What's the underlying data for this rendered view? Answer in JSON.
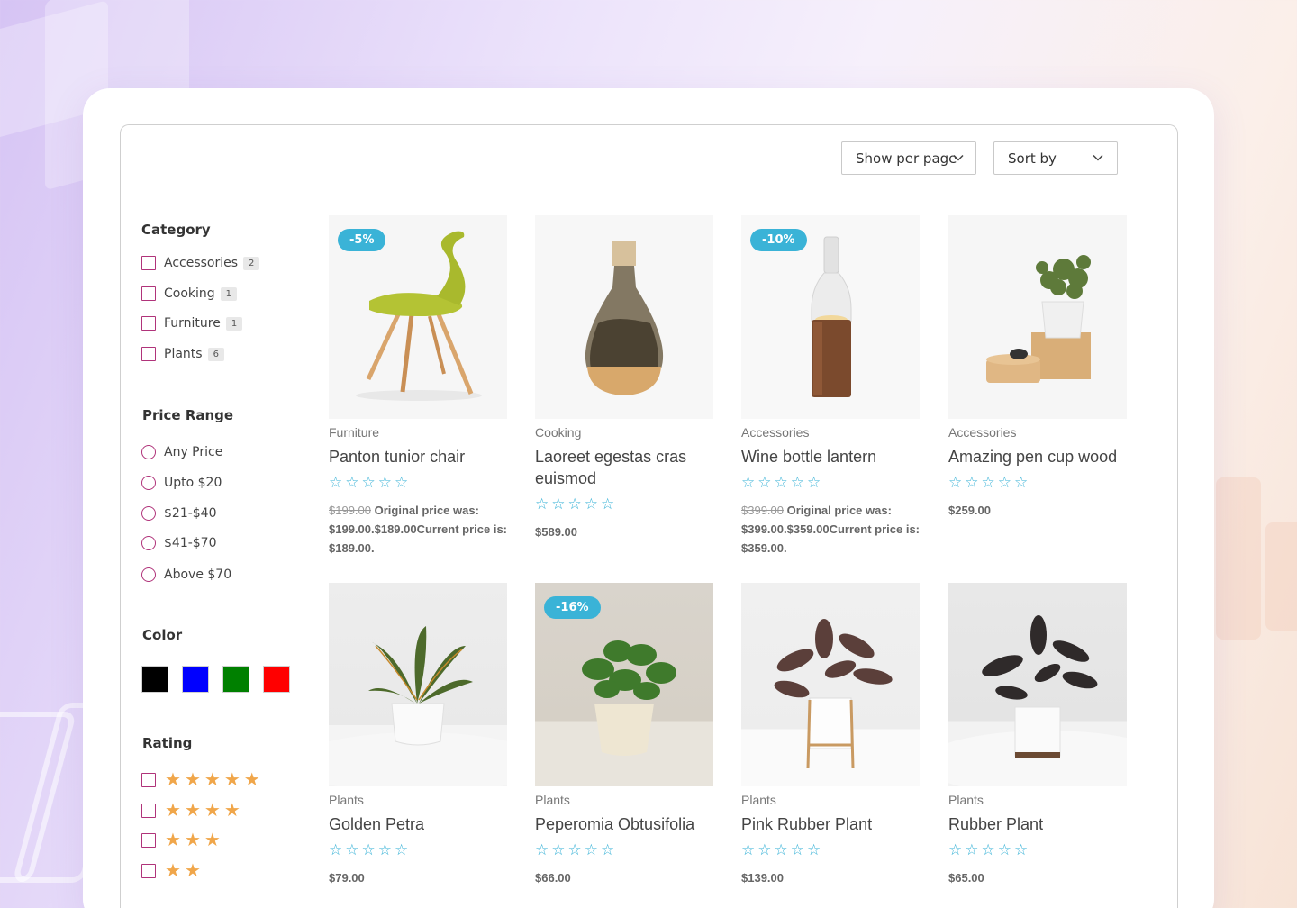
{
  "toolbar": {
    "per_page_label": "Show per page",
    "sort_label": "Sort by"
  },
  "sidebar": {
    "category_title": "Category",
    "categories": [
      {
        "label": "Accessories",
        "count": "2"
      },
      {
        "label": "Cooking",
        "count": "1"
      },
      {
        "label": "Furniture",
        "count": "1"
      },
      {
        "label": "Plants",
        "count": "6"
      }
    ],
    "price_title": "Price Range",
    "prices": [
      "Any Price",
      "Upto $20",
      "$21-$40",
      "$41-$70",
      "Above $70"
    ],
    "color_title": "Color",
    "colors": [
      "#000000",
      "#0000ff",
      "#008000",
      "#ff0000"
    ],
    "rating_title": "Rating",
    "ratings": [
      5,
      4,
      3,
      2
    ]
  },
  "products": [
    {
      "badge": "-5%",
      "category": "Furniture",
      "name": "Panton tunior chair",
      "old_price": "$199.00",
      "price_text": " Original price was: $199.00.$189.00Current price is: $189.00.",
      "rating": 0
    },
    {
      "badge": "",
      "category": "Cooking",
      "name": "Laoreet egestas cras euismod",
      "old_price": "",
      "price_text": "$589.00",
      "rating": 0
    },
    {
      "badge": "-10%",
      "category": "Accessories",
      "name": "Wine bottle lantern",
      "old_price": "$399.00",
      "price_text": " Original price was: $399.00.$359.00Current price is: $359.00.",
      "rating": 0
    },
    {
      "badge": "",
      "category": "Accessories",
      "name": "Amazing pen cup wood",
      "old_price": "",
      "price_text": "$259.00",
      "rating": 0
    },
    {
      "badge": "",
      "category": "Plants",
      "name": "Golden Petra",
      "old_price": "",
      "price_text": "$79.00",
      "rating": 0
    },
    {
      "badge": "-16%",
      "category": "Plants",
      "name": "Peperomia Obtusifolia",
      "old_price": "",
      "price_text": "$66.00",
      "rating": 0
    },
    {
      "badge": "",
      "category": "Plants",
      "name": "Pink Rubber Plant",
      "old_price": "",
      "price_text": "$139.00",
      "rating": 0
    },
    {
      "badge": "",
      "category": "Plants",
      "name": "Rubber Plant",
      "old_price": "",
      "price_text": "$65.00",
      "rating": 0
    }
  ]
}
